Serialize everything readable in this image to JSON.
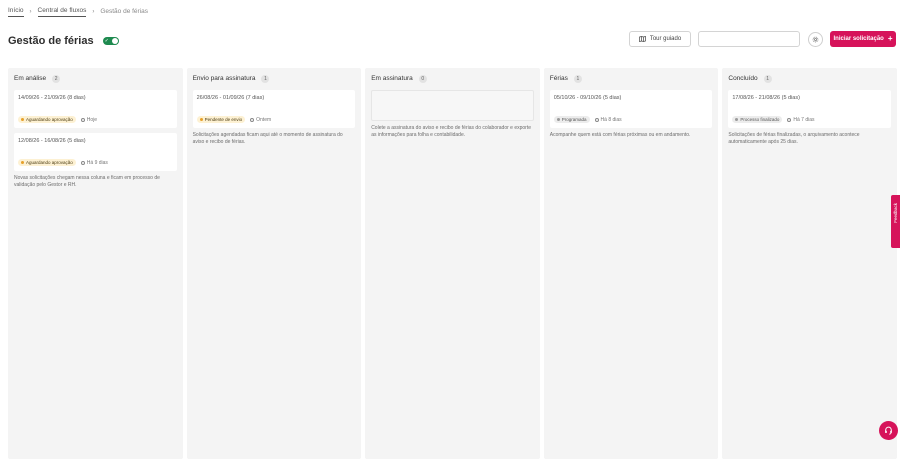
{
  "breadcrumb": {
    "items": [
      {
        "label": "Início"
      },
      {
        "label": "Central de fluxos"
      },
      {
        "label": "Gestão de férias"
      }
    ]
  },
  "header": {
    "title": "Gestão de férias",
    "tour_label": "Tour guiado",
    "search_placeholder": "",
    "primary_label": "Iniciar solicitação"
  },
  "columns": [
    {
      "title": "Em análise",
      "count": "2",
      "cards": [
        {
          "dates": "14/09/26 - 21/09/26 (8 dias)",
          "badge": "Aguardando aprovação",
          "badge_type": "warn",
          "time": "Hoje"
        },
        {
          "dates": "12/08/26 - 16/08/26 (5 dias)",
          "badge": "Aguardando aprovação",
          "badge_type": "warn",
          "time": "Há 9 dias"
        }
      ],
      "description": "Novas solicitações chegam nessa coluna e ficam em processo de validação pelo Gestor e RH."
    },
    {
      "title": "Envio para assinatura",
      "count": "1",
      "cards": [
        {
          "dates": "26/08/26 - 01/09/26 (7 dias)",
          "badge": "Pendente de envio",
          "badge_type": "warn",
          "time": "Ontem"
        }
      ],
      "description": "Solicitações agendadas ficam aqui até o momento de assinatura do aviso e recibo de férias."
    },
    {
      "title": "Em assinatura",
      "count": "0",
      "cards": [],
      "description": "Colete a assinatura do aviso e recibo de férias do colaborador e exporte as informações para folha e contabilidade."
    },
    {
      "title": "Férias",
      "count": "1",
      "cards": [
        {
          "dates": "05/10/26 - 09/10/26 (5 dias)",
          "badge": "Programada",
          "badge_type": "gray",
          "time": "Há 8 dias"
        }
      ],
      "description": "Acompanhe quem está com férias próximas ou em andamento."
    },
    {
      "title": "Concluído",
      "count": "1",
      "cards": [
        {
          "dates": "17/08/26 - 21/08/26 (5 dias)",
          "badge": "Processo finalizado",
          "badge_type": "gray",
          "time": "Há 7 dias"
        }
      ],
      "description": "Solicitações de férias finalizadas, o arquivamento acontece automaticamente após 25 dias."
    }
  ],
  "feedback_label": "Feedback",
  "colors": {
    "accent": "#d6135a",
    "toggle": "#1e8a4f",
    "warning": "#e7a12a"
  },
  "icons": {
    "tour": "map-icon",
    "settings": "gear-icon",
    "add": "plus-icon",
    "help": "headset-icon",
    "time": "clock-icon"
  }
}
